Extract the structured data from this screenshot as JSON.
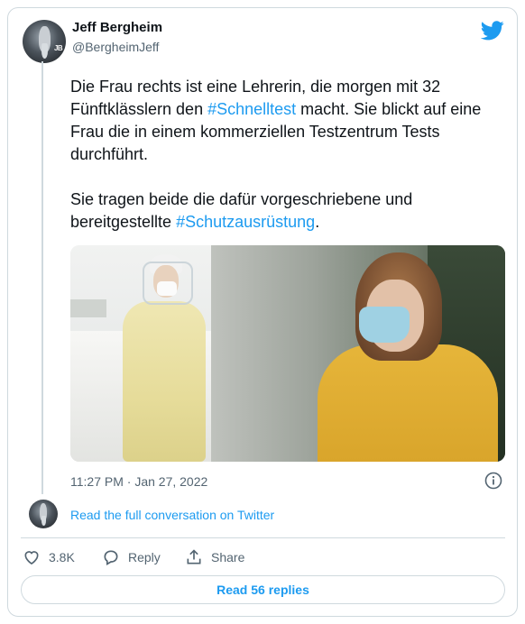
{
  "author": {
    "name": "Jeff Bergheim",
    "handle": "@BergheimJeff",
    "avatar_initials": "JB"
  },
  "tweet": {
    "p1_before": "Die Frau rechts ist eine Lehrerin, die morgen mit 32 Fünftklässlern den ",
    "p1_tag": "#Schnelltest",
    "p1_after": " macht. Sie blickt auf eine Frau die in einem kommerziellen Testzentrum Tests durchführt.",
    "p2_before": "Sie tragen beide die dafür vorgeschriebene und bereitgestellte ",
    "p2_tag": "#Schutzausrüstung",
    "p2_after": ".",
    "timestamp": "11:27 PM · Jan 27, 2022"
  },
  "links": {
    "read_conversation": "Read the full conversation on Twitter",
    "read_replies": "Read 56 replies"
  },
  "actions": {
    "likes": "3.8K",
    "reply": "Reply",
    "share": "Share"
  },
  "icons": [
    "twitter-bird-icon",
    "info-icon",
    "heart-icon",
    "reply-bubble-icon",
    "share-icon"
  ],
  "colors": {
    "accent": "#1d9bf0",
    "text": "#0f1419",
    "secondary": "#536471",
    "border": "#cfd9de"
  }
}
